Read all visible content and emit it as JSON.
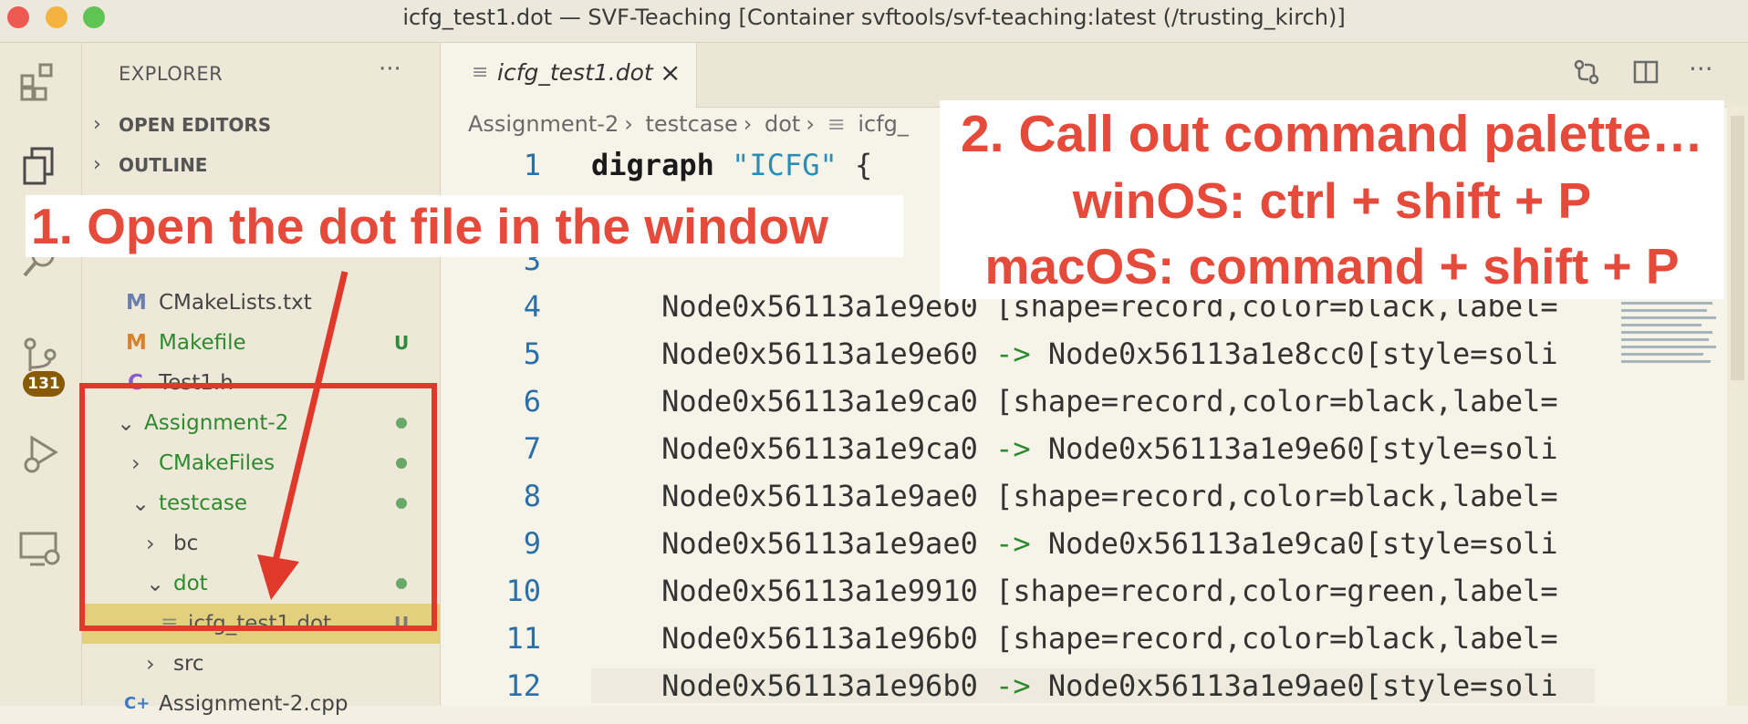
{
  "window": {
    "title": "icfg_test1.dot — SVF-Teaching [Container svftools/svf-teaching:latest (/trusting_kirch)]",
    "traffic_colors": [
      "#ee5a52",
      "#f4b33f",
      "#5fc453"
    ]
  },
  "activity_bar": {
    "badge": "131",
    "icons": [
      "extensions-icon",
      "explorer-icon",
      "search-icon",
      "source-control-icon",
      "run-debug-icon",
      "remote-explorer-icon"
    ]
  },
  "sidebar": {
    "title": "EXPLORER",
    "more": "···",
    "sections": [
      {
        "label": "OPEN EDITORS",
        "chevron": "›"
      },
      {
        "label": "OUTLINE",
        "chevron": "›"
      }
    ],
    "tree": [
      {
        "icon": "M",
        "icon_color": "#6a7fb0",
        "label": "CMakeLists.txt",
        "status": ""
      },
      {
        "icon": "M",
        "icon_color": "#d9822b",
        "label": "Makefile",
        "status": "U"
      },
      {
        "icon": "C",
        "icon_color": "#8a5bd0",
        "label": "Test1.h",
        "status": ""
      },
      {
        "chevron": "⌄",
        "label": "Assignment-2",
        "status": "dot"
      },
      {
        "chevron": "›",
        "label": "CMakeFiles",
        "status": "dot"
      },
      {
        "chevron": "⌄",
        "label": "testcase",
        "status": "dot"
      },
      {
        "chevron": "›",
        "label": "bc",
        "status": ""
      },
      {
        "chevron": "⌄",
        "label": "dot",
        "status": "dot"
      },
      {
        "icon": "≡",
        "label": "icfg_test1.dot",
        "status": "U"
      },
      {
        "chevron": "›",
        "label": "src",
        "status": ""
      },
      {
        "icon": "C+",
        "icon_color": "#3a78c8",
        "label": "Assignment-2.cpp",
        "status": ""
      }
    ]
  },
  "editor": {
    "tab": {
      "label": "icfg_test1.dot",
      "close": "×"
    },
    "breadcrumb": [
      "Assignment-2",
      "testcase",
      "dot",
      "icfg_"
    ],
    "line_numbers": [
      "1",
      "3",
      "4",
      "5",
      "6",
      "7",
      "8",
      "9",
      "10",
      "11",
      "12"
    ],
    "code": {
      "l1_kw": "digraph",
      "l1_str": "\"ICFG\"",
      "l1_rest": " {",
      "l4": "    Node0x56113a1e9e60 [shape=record,color=black,label=",
      "l5_a": "    Node0x56113a1e9e60 ",
      "l5_b": "->",
      "l5_c": " Node0x56113a1e8cc0[style=soli",
      "l6": "    Node0x56113a1e9ca0 [shape=record,color=black,label=",
      "l7_a": "    Node0x56113a1e9ca0 ",
      "l7_b": "->",
      "l7_c": " Node0x56113a1e9e60[style=soli",
      "l8": "    Node0x56113a1e9ae0 [shape=record,color=black,label=",
      "l9_a": "    Node0x56113a1e9ae0 ",
      "l9_b": "->",
      "l9_c": " Node0x56113a1e9ca0[style=soli",
      "l10": "    Node0x56113a1e9910 [shape=record,color=green,label=",
      "l11": "    Node0x56113a1e96b0 [shape=record,color=black,label=",
      "l12_a": "    Node0x56113a1e96b0 ",
      "l12_b": "->",
      "l12_c": " Node0x56113a1e9ae0[style=soli"
    }
  },
  "annotations": {
    "step1": "1. Open the dot file in the window",
    "step2_l1": "2. Call out command palette…",
    "step2_l2": "winOS: ctrl + shift + P",
    "step2_l3": "macOS: command + shift + P",
    "color": "#e54a3a"
  }
}
